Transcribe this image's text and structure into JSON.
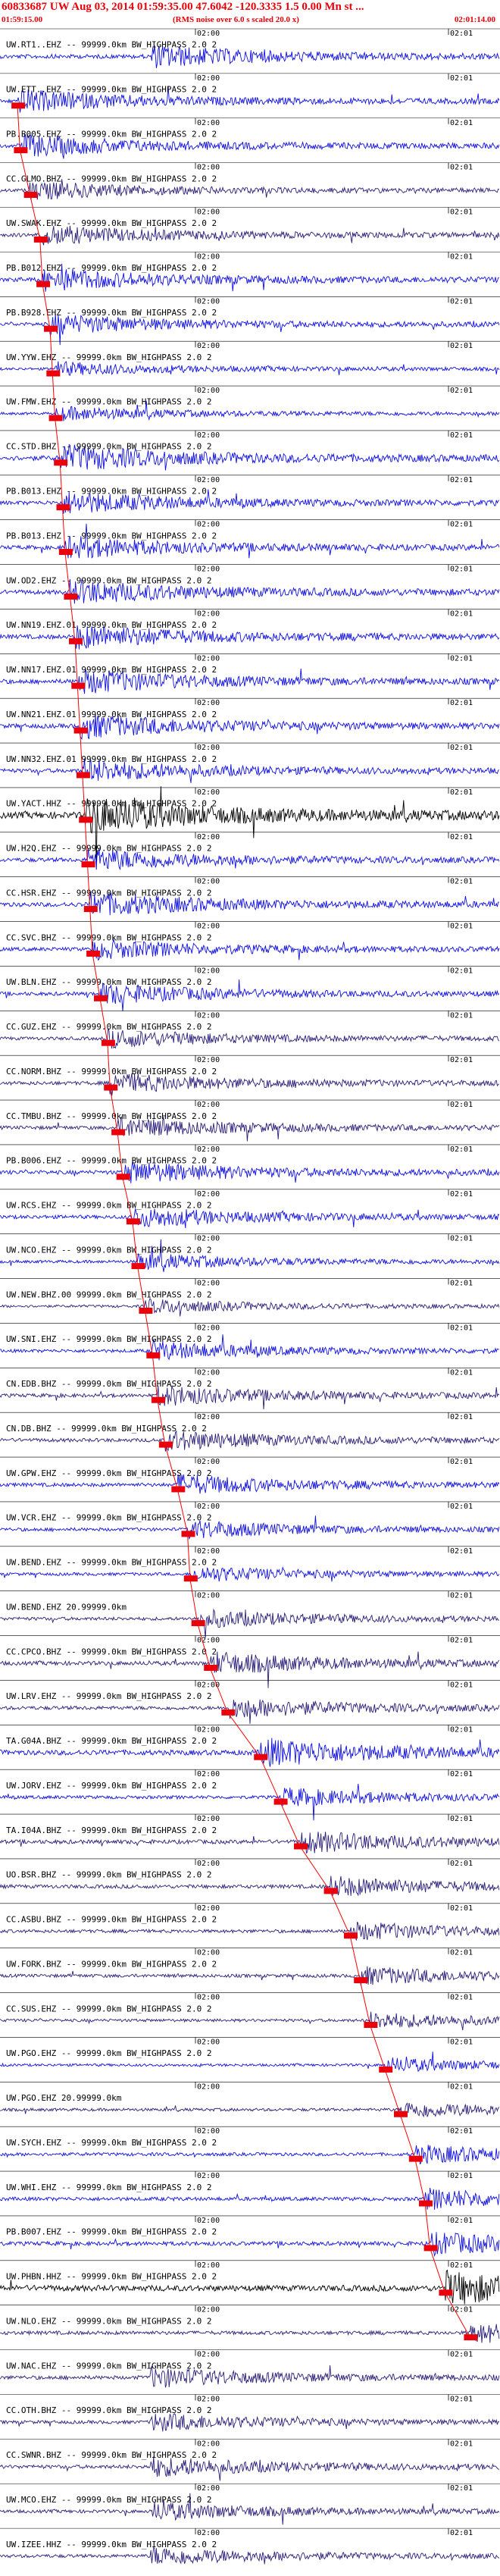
{
  "header": {
    "title": "60833687 UW Aug 03, 2014 01:59:35.00   47.6042 -120.3335  1.5 0.00 Mn st  ...",
    "start_time": "01:59:15.00",
    "note": "(RMS noise over 6.0 s scaled 20.0 x)",
    "end_time": "02:01:14.00"
  },
  "chart_data": {
    "type": "line",
    "title": "60833687 UW Aug 03, 2014 01:59:35.00   47.6042 -120.3335  1.5 0.00 Mn st  ...",
    "time_range": [
      "01:59:15.00",
      "02:01:14.00"
    ],
    "tick_labels": [
      "02:00",
      "02:01"
    ],
    "colors": {
      "marker": "#e8000a",
      "pick_line": "#ff0000",
      "trace_palette": [
        "#1010e0",
        "#2a1f7a",
        "#000000"
      ]
    },
    "traces": [
      {
        "label": "UW.RT1..EHZ -- 99999.0km BW_HIGHPASS  2.0  2",
        "color": "#1010e0",
        "amp": 0.55,
        "pick": null
      },
      {
        "label": "UW.ETT..EHZ -- 99999.0km BW_HIGHPASS  2.0  2",
        "color": "#1010e0",
        "amp": 0.55,
        "pick": 0.035
      },
      {
        "label": "PB.B005.EHZ -- 99999.0km BW_HIGHPASS  2.0  2",
        "color": "#1010e0",
        "amp": 0.55,
        "pick": 0.04
      },
      {
        "label": "CC.GLMO.BHZ -- 99999.0km BW_HIGHPASS  2.0  2",
        "color": "#2a1f7a",
        "amp": 0.45,
        "pick": 0.06
      },
      {
        "label": "UW.SWAK.EHZ -- 99999.0km BW_HIGHPASS  2.0  2",
        "color": "#2a1f7a",
        "amp": 0.5,
        "pick": 0.08
      },
      {
        "label": "PB.B012.EHZ -- 99999.0km BW_HIGHPASS  2.0  2",
        "color": "#1010e0",
        "amp": 0.55,
        "pick": 0.085
      },
      {
        "label": "PB.B928.EHZ -- 99999.0km BW_HIGHPASS  2.0  2",
        "color": "#1010e0",
        "amp": 0.5,
        "pick": 0.1
      },
      {
        "label": "UW.YYW.EHZ -- 99999.0km BW_HIGHPASS  2.0  2",
        "color": "#1010e0",
        "amp": 0.35,
        "pick": 0.105
      },
      {
        "label": "UW.FMW.EHZ -- 99999.0km BW_HIGHPASS  2.0  2",
        "color": "#1010e0",
        "amp": 0.35,
        "pick": 0.11
      },
      {
        "label": "CC.STD.BHZ -- 99999.0km BW_HIGHPASS  2.0  2",
        "color": "#1010e0",
        "amp": 0.65,
        "pick": 0.12
      },
      {
        "label": "PB.B013.EHZ -- 99999.0km BW_HIGHPASS  2.0  2",
        "color": "#1010e0",
        "amp": 0.55,
        "pick": 0.125
      },
      {
        "label": "PB.B013.EHZ -- 99999.0km BW_HIGHPASS  2.0  2",
        "color": "#1010e0",
        "amp": 0.55,
        "pick": 0.13
      },
      {
        "label": "UW.OD2.EHZ -- 99999.0km BW_HIGHPASS  2.0  2",
        "color": "#1010e0",
        "amp": 0.6,
        "pick": 0.14
      },
      {
        "label": "UW.NN19.EHZ.01 99999.0km BW_HIGHPASS  2.0  2",
        "color": "#1010e0",
        "amp": 0.6,
        "pick": 0.15
      },
      {
        "label": "UW.NN17.EHZ.01 99999.0km BW_HIGHPASS  2.0  2",
        "color": "#1010e0",
        "amp": 0.6,
        "pick": 0.155
      },
      {
        "label": "UW.NN21.EHZ.01 99999.0km BW_HIGHPASS  2.0  2",
        "color": "#1010e0",
        "amp": 0.6,
        "pick": 0.16
      },
      {
        "label": "UW.NN32.EHZ.01 99999.0km BW_HIGHPASS  2.0  2",
        "color": "#1010e0",
        "amp": 0.55,
        "pick": 0.165
      },
      {
        "label": "UW.YACT.HHZ -- 99999.0km BW_HIGHPASS  2.0  2",
        "color": "#000000",
        "amp": 0.9,
        "pick": 0.17
      },
      {
        "label": "UW.H2Q.EHZ -- 99999.0km BW_HIGHPASS  2.0  2",
        "color": "#1010e0",
        "amp": 0.55,
        "pick": 0.175
      },
      {
        "label": "CC.HSR.EHZ -- 99999.0km BW_HIGHPASS  2.0  2",
        "color": "#1010e0",
        "amp": 0.6,
        "pick": 0.18
      },
      {
        "label": "CC.SVC.BHZ -- 99999.0km BW_HIGHPASS  2.0  2",
        "color": "#1010e0",
        "amp": 0.5,
        "pick": 0.185
      },
      {
        "label": "UW.BLN.EHZ -- 99999.0km BW_HIGHPASS  2.0  2",
        "color": "#1010e0",
        "amp": 0.5,
        "pick": 0.2
      },
      {
        "label": "CC.GUZ.EHZ -- 99999.0km BW_HIGHPASS  2.0  2",
        "color": "#2a1f7a",
        "amp": 0.45,
        "pick": 0.215
      },
      {
        "label": "CC.NORM.BHZ -- 99999.0km BW_HIGHPASS  2.0  2",
        "color": "#2a1f7a",
        "amp": 0.5,
        "pick": 0.22
      },
      {
        "label": "CC.TMBU.BHZ -- 99999.0km BW_HIGHPASS  2.0  2",
        "color": "#2a1f7a",
        "amp": 0.5,
        "pick": 0.235
      },
      {
        "label": "PB.B006.EHZ -- 99999.0km BW_HIGHPASS  2.0  2",
        "color": "#1010e0",
        "amp": 0.55,
        "pick": 0.245
      },
      {
        "label": "UW.RCS.EHZ -- 99999.0km BW_HIGHPASS  2.0  2",
        "color": "#1010e0",
        "amp": 0.5,
        "pick": 0.265
      },
      {
        "label": "UW.NCO.EHZ -- 99999.0km BW_HIGHPASS  2.0  2",
        "color": "#1010e0",
        "amp": 0.4,
        "pick": 0.275
      },
      {
        "label": "UW.NEW.BHZ.00 99999.0km BW_HIGHPASS  2.0  2",
        "color": "#2a1f7a",
        "amp": 0.35,
        "pick": 0.29
      },
      {
        "label": "UW.SNI.EHZ -- 99999.0km BW_HIGHPASS  2.0  2",
        "color": "#1010e0",
        "amp": 0.45,
        "pick": 0.305
      },
      {
        "label": "CN.EDB.BHZ -- 99999.0km BW_HIGHPASS  2.0  2",
        "color": "#2a1f7a",
        "amp": 0.5,
        "pick": 0.315
      },
      {
        "label": "CN.DB.BHZ -- 99999.0km BW_HIGHPASS  2.0  2",
        "color": "#2a1f7a",
        "amp": 0.5,
        "pick": 0.33
      },
      {
        "label": "UW.GPW.EHZ -- 99999.0km BW_HIGHPASS  2.0  2",
        "color": "#1010e0",
        "amp": 0.5,
        "pick": 0.355
      },
      {
        "label": "UW.VCR.EHZ -- 99999.0km BW_HIGHPASS  2.0  2",
        "color": "#1010e0",
        "amp": 0.45,
        "pick": 0.375
      },
      {
        "label": "UW.BEND.EHZ -- 99999.0km BW_HIGHPASS  2.0  2",
        "color": "#1010e0",
        "amp": 0.4,
        "pick": 0.38
      },
      {
        "label": "UW.BEND.EHZ 20.99999.0km",
        "color": "#2a1f7a",
        "amp": 0.45,
        "pick": 0.395
      },
      {
        "label": "CC.CPCO.BHZ -- 99999.0km BW_HIGHPASS  2.0  2",
        "color": "#2a1f7a",
        "amp": 0.55,
        "pick": 0.42
      },
      {
        "label": "UW.LRV.EHZ -- 99999.0km BW_HIGHPASS  2.0  2",
        "color": "#2a1f7a",
        "amp": 0.5,
        "pick": 0.455
      },
      {
        "label": "TA.G04A.BHZ -- 99999.0km BW_HIGHPASS  2.0  2",
        "color": "#1010e0",
        "amp": 0.7,
        "pick": 0.52
      },
      {
        "label": "UW.JORV.EHZ -- 99999.0km BW_HIGHPASS  2.0  2",
        "color": "#1010e0",
        "amp": 0.45,
        "pick": 0.56
      },
      {
        "label": "TA.I04A.BHZ -- 99999.0km BW_HIGHPASS  2.0  2",
        "color": "#2a1f7a",
        "amp": 0.55,
        "pick": 0.6
      },
      {
        "label": "UO.BSR.BHZ -- 99999.0km BW_HIGHPASS  2.0  2",
        "color": "#2a1f7a",
        "amp": 0.5,
        "pick": 0.66
      },
      {
        "label": "CC.ASBU.BHZ -- 99999.0km BW_HIGHPASS  2.0  2",
        "color": "#2a1f7a",
        "amp": 0.45,
        "pick": 0.7
      },
      {
        "label": "UW.FORK.BHZ -- 99999.0km BW_HIGHPASS  2.0  2",
        "color": "#2a1f7a",
        "amp": 0.45,
        "pick": 0.72
      },
      {
        "label": "CC.SUS.EHZ -- 99999.0km BW_HIGHPASS  2.0  2",
        "color": "#2a1f7a",
        "amp": 0.4,
        "pick": 0.74
      },
      {
        "label": "UW.PGO.EHZ -- 99999.0km BW_HIGHPASS  2.0  2",
        "color": "#1010e0",
        "amp": 0.35,
        "pick": 0.77
      },
      {
        "label": "UW.PGO.EHZ 20.99999.0km",
        "color": "#2a1f7a",
        "amp": 0.4,
        "pick": 0.8
      },
      {
        "label": "UW.SYCH.EHZ -- 99999.0km BW_HIGHPASS  2.0  2",
        "color": "#1010e0",
        "amp": 0.45,
        "pick": 0.83
      },
      {
        "label": "UW.WHI.EHZ -- 99999.0km BW_HIGHPASS  2.0  2",
        "color": "#1010e0",
        "amp": 0.5,
        "pick": 0.85
      },
      {
        "label": "PB.B007.EHZ -- 99999.0km BW_HIGHPASS  2.0  2",
        "color": "#1010e0",
        "amp": 0.55,
        "pick": 0.86
      },
      {
        "label": "UW.PHBN.HHZ -- 99999.0km BW_HIGHPASS  2.0  2",
        "color": "#000000",
        "amp": 0.8,
        "pick": 0.89
      },
      {
        "label": "UW.NLO.EHZ -- 99999.0km BW_HIGHPASS  2.0  2",
        "color": "#2a1f7a",
        "amp": 0.5,
        "pick": 0.94
      },
      {
        "label": "UW.NAC.EHZ -- 99999.0km BW_HIGHPASS  2.0  2",
        "color": "#2a1f7a",
        "amp": 0.5,
        "pick": null
      },
      {
        "label": "CC.OTH.BHZ -- 99999.0km BW_HIGHPASS  2.0  2",
        "color": "#2a1f7a",
        "amp": 0.45,
        "pick": null
      },
      {
        "label": "CC.SWNR.BHZ -- 99999.0km BW_HIGHPASS  2.0  2",
        "color": "#2a1f7a",
        "amp": 0.5,
        "pick": null
      },
      {
        "label": "UW.MCO.EHZ -- 99999.0km BW_HIGHPASS  2.0  2",
        "color": "#2a1f7a",
        "amp": 0.45,
        "pick": null
      },
      {
        "label": "UW.IZEE.HHZ -- 99999.0km BW_HIGHPASS  2.0  2",
        "color": "#2a1f7a",
        "amp": 0.45,
        "pick": null
      }
    ]
  }
}
